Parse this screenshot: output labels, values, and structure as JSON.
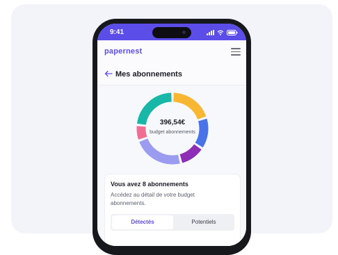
{
  "statusbar": {
    "time": "9:41"
  },
  "app": {
    "logo": "papernest"
  },
  "header": {
    "title": "Mes abonnements"
  },
  "budget": {
    "amount": "396,54€",
    "label": "budget abonnements",
    "segment_colors": [
      "#19b7a7",
      "#f7b733",
      "#4a73e8",
      "#8e2db5",
      "#9b9cf0",
      "#f06e93"
    ]
  },
  "summary": {
    "title": "Vous avez 8 abonnements",
    "description": "Accédez au détail de votre budget abonnements."
  },
  "tabs": [
    {
      "label": "Détectés",
      "active": true
    },
    {
      "label": "Potentiels",
      "active": false
    }
  ],
  "colors": {
    "accent": "#5b4de8"
  }
}
